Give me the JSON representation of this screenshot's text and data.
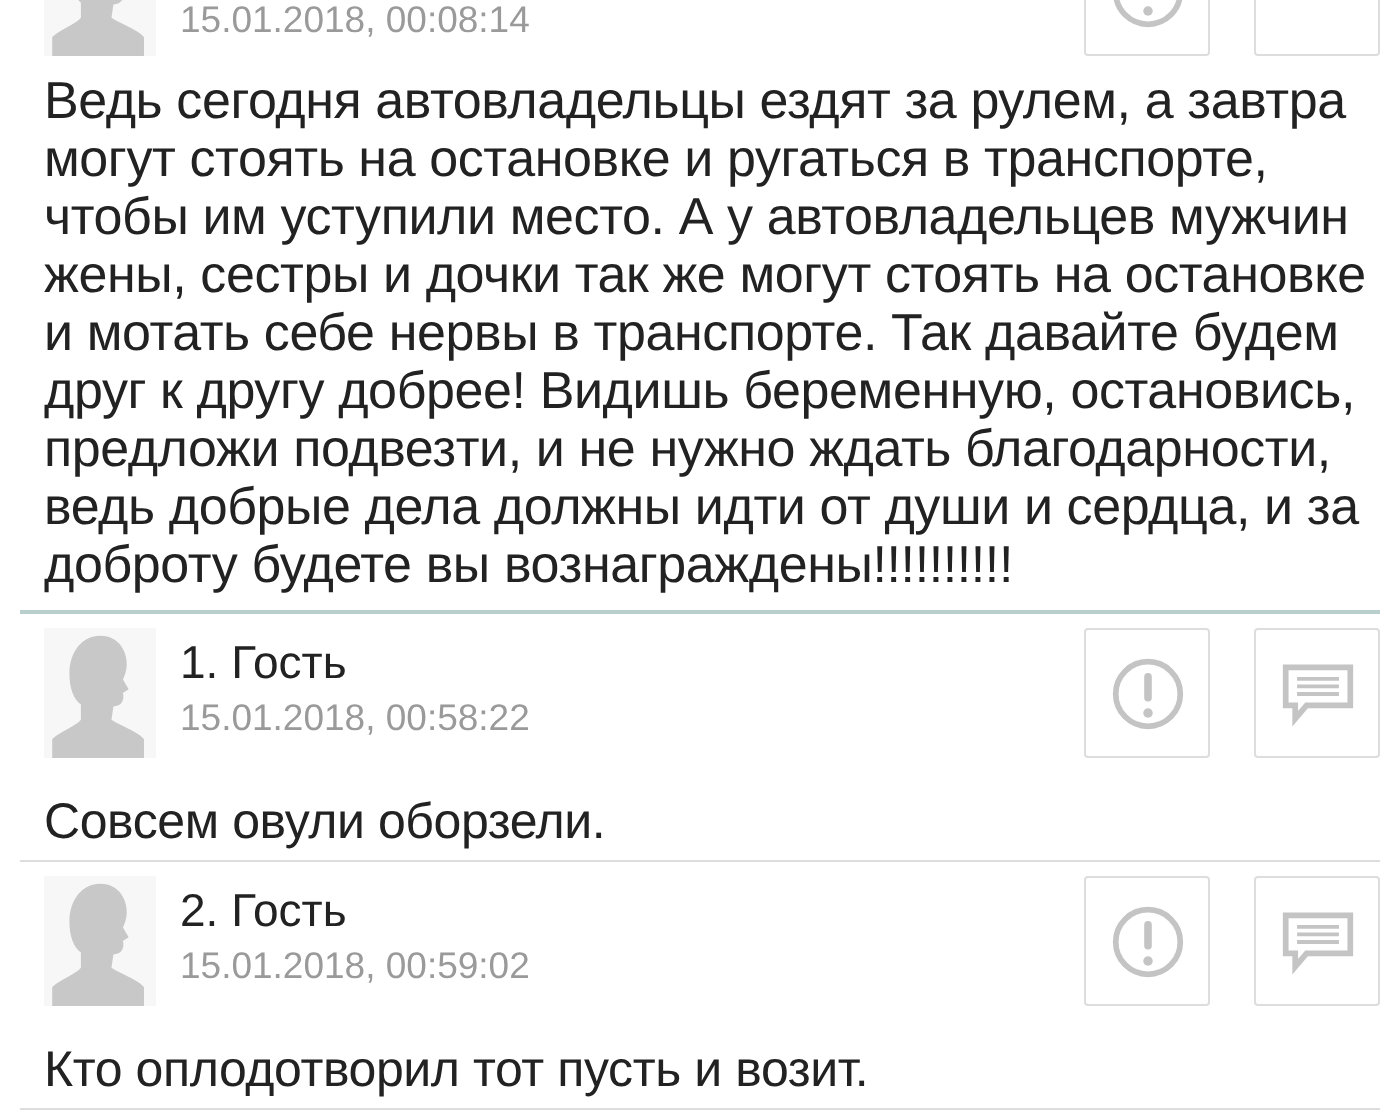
{
  "post": {
    "date": "15.01.2018, 00:08:14",
    "text": "Ведь сегодня автовладельцы ездят за рулем, а завтра могут стоять на остановке и ругаться в транспорте, чтобы им уступили место. А у автовладельцев мужчин жены, сестры и дочки так же могут стоять на остановке и мотать себе нервы в транспорте. Так давайте будем друг к другу добрее! Видишь беременную, остановись, предложи подвезти, и не нужно ждать благодарности, ведь добрые дела должны идти от души и сердца, и за доброту будете вы вознаграждены!!!!!!!!!!"
  },
  "comments": [
    {
      "author": "1. Гость",
      "date": "15.01.2018, 00:58:22",
      "text": "Совсем овули оборзели."
    },
    {
      "author": "2. Гость",
      "date": "15.01.2018, 00:59:02",
      "text": "Кто оплодотворил тот пусть и возит."
    }
  ]
}
